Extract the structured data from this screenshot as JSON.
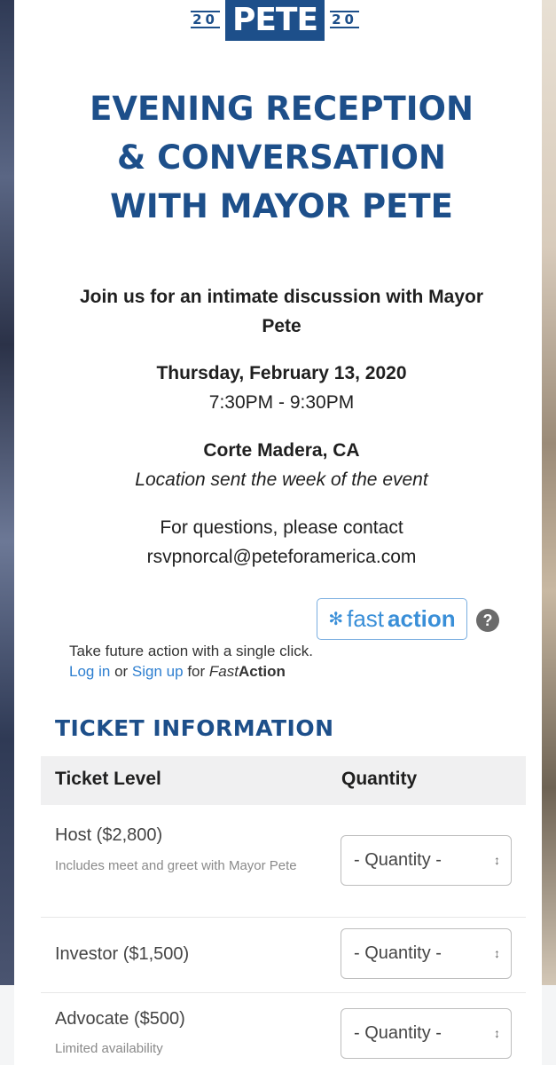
{
  "logo": {
    "year_left": "20",
    "name": "PETE",
    "year_right": "20"
  },
  "event": {
    "title_lines": [
      "EVENING RECEPTION",
      "& CONVERSATION",
      "WITH MAYOR PETE"
    ],
    "intro": "Join us for an intimate discussion with Mayor Pete",
    "date": "Thursday, February 13, 2020",
    "time": "7:30PM - 9:30PM",
    "location": "Corte Madera, CA",
    "location_note": "Location sent the week of the event",
    "contact_line": "For questions, please contact",
    "contact_email": "rsvpnorcal@peteforamerica.com"
  },
  "fastaction": {
    "icon": "fastaction-logo-icon",
    "brand_fast": "fast",
    "brand_action": "action",
    "help": "?",
    "tagline": "Take future action with a single click.",
    "login": "Log in",
    "or": "or",
    "signup": "Sign up",
    "for": "for",
    "brand2_fast": "Fast",
    "brand2_action": "Action"
  },
  "tickets": {
    "heading": "TICKET INFORMATION",
    "col_level": "Ticket Level",
    "col_quantity": "Quantity",
    "rows": [
      {
        "name": "Host ($2,800)",
        "note": "Includes meet and greet with Mayor Pete",
        "quantity": "- Quantity -"
      },
      {
        "name": "Investor ($1,500)",
        "note": "",
        "quantity": "- Quantity -"
      },
      {
        "name": "Advocate ($500)",
        "note": "Limited availability",
        "quantity": "- Quantity -"
      }
    ]
  },
  "colors": {
    "brand_blue": "#1d4f8a",
    "link_blue": "#2e7fd0"
  }
}
